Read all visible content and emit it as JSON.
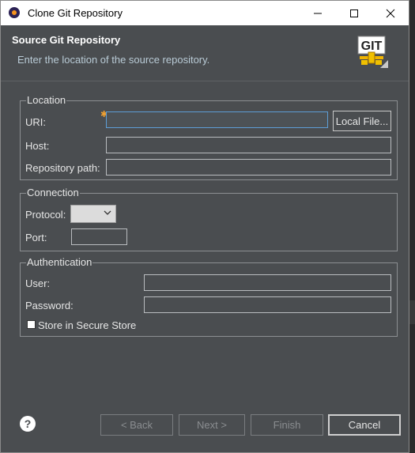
{
  "window": {
    "title": "Clone Git Repository"
  },
  "header": {
    "title": "Source Git Repository",
    "description": "Enter the location of the source repository.",
    "logo_text": "GIT"
  },
  "location": {
    "group_label": "Location",
    "uri_label": "URI:",
    "uri_value": "",
    "host_label": "Host:",
    "host_value": "",
    "repo_path_label": "Repository path:",
    "repo_path_value": "",
    "local_file_button": "Local File..."
  },
  "connection": {
    "group_label": "Connection",
    "protocol_label": "Protocol:",
    "protocol_value": "",
    "port_label": "Port:",
    "port_value": ""
  },
  "authentication": {
    "group_label": "Authentication",
    "user_label": "User:",
    "user_value": "",
    "password_label": "Password:",
    "password_value": "",
    "secure_store_label": "Store in Secure Store",
    "secure_store_checked": false
  },
  "footer": {
    "back_button": "< Back",
    "next_button": "Next >",
    "finish_button": "Finish",
    "cancel_button": "Cancel",
    "help_icon": "?"
  },
  "colors": {
    "dialog_bg": "#4a4d50",
    "header_desc": "#b9cbd6",
    "focus_border": "#5e9ed6"
  }
}
